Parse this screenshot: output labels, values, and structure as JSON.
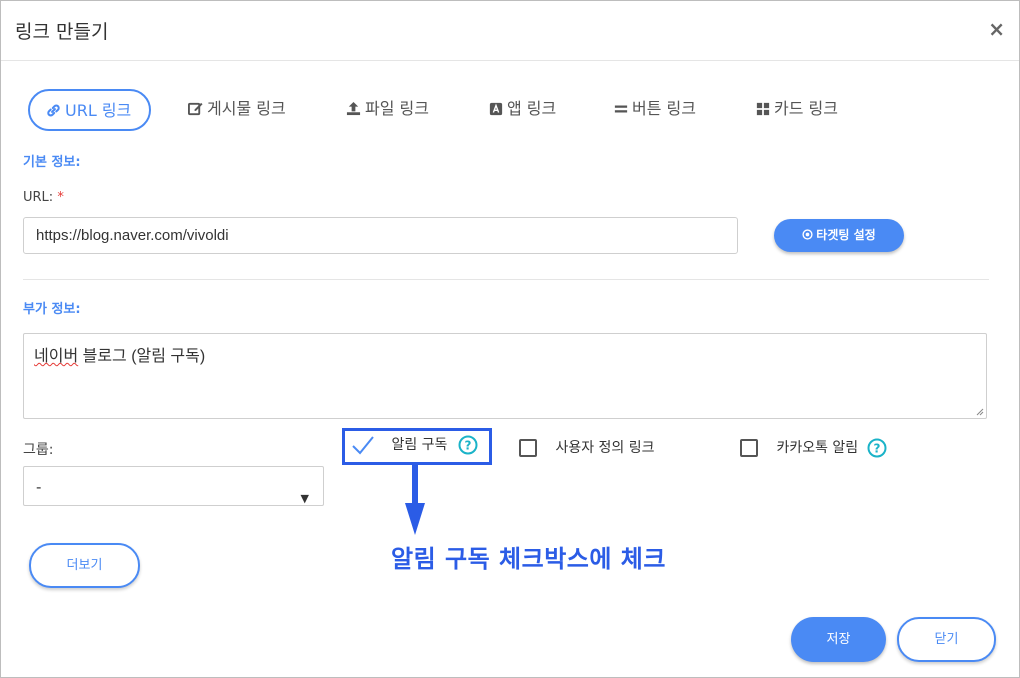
{
  "dialog": {
    "title": "링크 만들기",
    "close_glyph": "×"
  },
  "tabs": [
    {
      "label": "URL 링크",
      "icon": "link-icon",
      "active": true
    },
    {
      "label": "게시물 링크",
      "icon": "edit-icon",
      "active": false
    },
    {
      "label": "파일 링크",
      "icon": "upload-icon",
      "active": false
    },
    {
      "label": "앱 링크",
      "icon": "app-store-icon",
      "active": false
    },
    {
      "label": "버튼 링크",
      "icon": "button-bars-icon",
      "active": false
    },
    {
      "label": "카드 링크",
      "icon": "grid-icon",
      "active": false
    }
  ],
  "basic": {
    "section_label": "기본 정보:",
    "url_label": "URL:",
    "required_mark": "*",
    "url_value": "https://blog.naver.com/vivoldi",
    "targeting_button": "타겟팅 설정"
  },
  "extra": {
    "section_label": "부가 정보:",
    "memo_value": "네이버 블로그 (알림 구독)",
    "memo_squiggle_word": "네이버",
    "memo_rest": " 블로그 (알림 구독)"
  },
  "group": {
    "label": "그룹:",
    "selected": "-"
  },
  "options": [
    {
      "label": "알림 구독",
      "checked": true,
      "help": true
    },
    {
      "label": "사용자 정의 링크",
      "checked": false,
      "help": false
    },
    {
      "label": "카카오톡 알림",
      "checked": false,
      "help": true
    }
  ],
  "more_button": "더보기",
  "footer": {
    "save_label": "저장",
    "close_label": "닫기"
  },
  "annotation": {
    "text": "알림 구독 체크박스에 체크"
  },
  "colors": {
    "accent": "#4a8af4",
    "annotation": "#2b5ce6",
    "help": "#1ab3c8",
    "required": "#e53935"
  }
}
